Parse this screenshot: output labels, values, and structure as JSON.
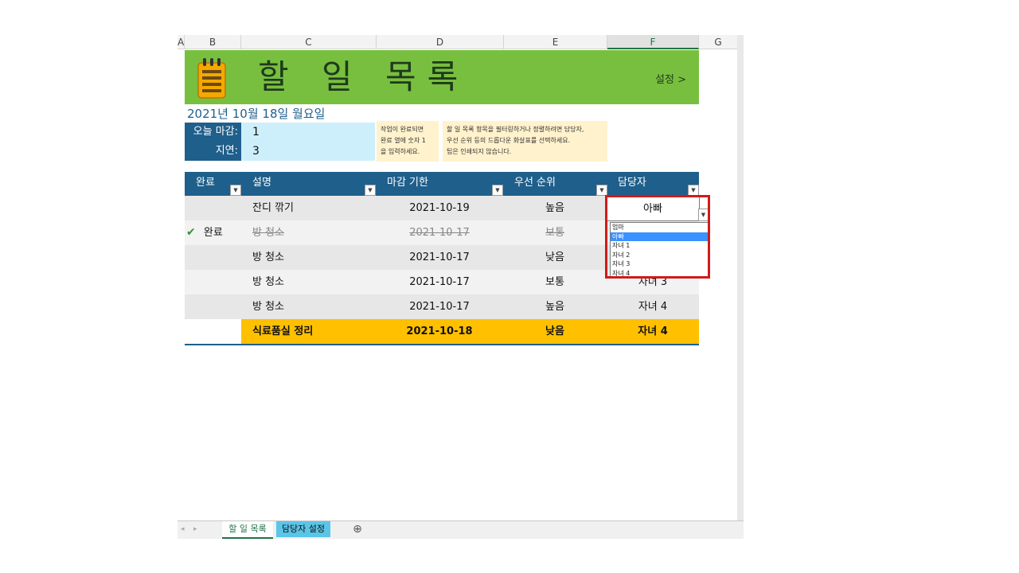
{
  "columns": [
    "A",
    "B",
    "C",
    "D",
    "E",
    "F",
    "G"
  ],
  "banner": {
    "title": "할 일 목록",
    "settings": "설정 >",
    "bg": "#78bf3f"
  },
  "date": "2021년 10월 18일 월요일",
  "summary": {
    "today_label": "오늘 마감:",
    "today_value": "1",
    "late_label": "지연:",
    "late_value": "3"
  },
  "notes": {
    "note1": [
      "작업이 완료되면",
      "완료 열에 숫자 1",
      "을 입력하세요."
    ],
    "note2": [
      "할 일 목록 항목을 필터링하거나 정렬하려면 담당자,",
      "우선 순위 등의 드롭다운 화살표를 선택하세요.",
      "팁은 인쇄되지 않습니다."
    ]
  },
  "table": {
    "headers": [
      "완료",
      "설명",
      "마감 기한",
      "우선 순위",
      "담당자"
    ],
    "filter_icon": "▼",
    "rows": [
      {
        "done": "",
        "desc": "잔디 깎기",
        "due": "2021-10-19",
        "priority": "높음",
        "owner": "아빠"
      },
      {
        "done": "완료",
        "desc": "방 청소",
        "due": "2021-10-17",
        "priority": "보통",
        "owner": ""
      },
      {
        "done": "",
        "desc": "방 청소",
        "due": "2021-10-17",
        "priority": "낮음",
        "owner": ""
      },
      {
        "done": "",
        "desc": "방 청소",
        "due": "2021-10-17",
        "priority": "보통",
        "owner": "자녀 3"
      },
      {
        "done": "",
        "desc": "방 청소",
        "due": "2021-10-17",
        "priority": "높음",
        "owner": "자녀 4"
      },
      {
        "done": "",
        "desc": "식료품실 정리",
        "due": "2021-10-18",
        "priority": "낮음",
        "owner": "자녀 4"
      }
    ]
  },
  "dropdown": {
    "value": "아빠",
    "options": [
      "엄마",
      "아빠",
      "자녀 1",
      "자녀 2",
      "자녀 3",
      "자녀 4"
    ],
    "highlighted": 1
  },
  "sheet_tabs": [
    {
      "label": "할 일 목록",
      "active": true
    },
    {
      "label": "담당자 설정",
      "active": false
    }
  ],
  "add_sheet": "⊕",
  "colors": {
    "header": "#1f5f8b",
    "highlight_row": "#ffc000",
    "summary_bg": "#cdeffb",
    "note_bg": "#fff2cc"
  }
}
